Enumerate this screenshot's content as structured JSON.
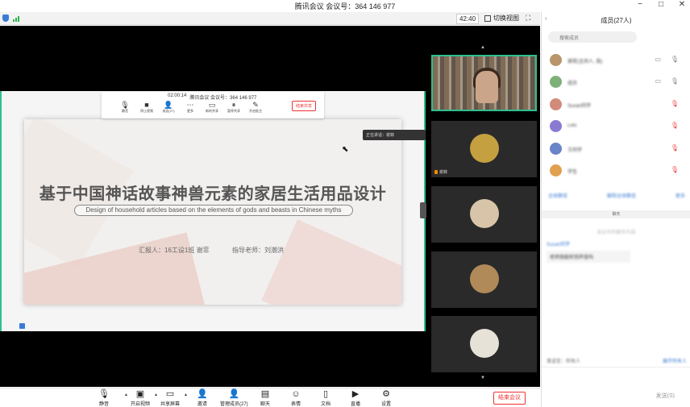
{
  "window": {
    "title": "腾讯会议 会议号：364 146 977",
    "buttons": [
      "−",
      "□",
      "✕"
    ]
  },
  "status": {
    "timer": "42:40",
    "switch_view": "切换视图",
    "fullscreen_icon": "⛶"
  },
  "share_bar": {
    "elapsed": "02:00:14",
    "meeting_id": "腾讯会议 会议号：364 146 977",
    "items": [
      {
        "label": "静音",
        "icon": "mic-icon"
      },
      {
        "label": "停止视频",
        "icon": "camera-icon"
      },
      {
        "label": "成员(27)",
        "icon": "members-icon"
      },
      {
        "label": "更多",
        "icon": "more-icon"
      },
      {
        "label": "新的共享",
        "icon": "share-icon"
      },
      {
        "label": "暂停共享",
        "icon": "pause-icon"
      },
      {
        "label": "开启批注",
        "icon": "annotate-icon"
      }
    ],
    "end_share": "结束共享"
  },
  "slide": {
    "title": "基于中国神话故事神兽元素的家居生活用品设计",
    "subtitle": "Design of household articles based on the elements of gods and beasts in Chinese myths",
    "reporter": "汇报人：16工设1班 谢菲",
    "advisor": "指导老师：刘潮洪"
  },
  "tooltip": "正在讲话：谢菲",
  "thumbnails": [
    "谢菲",
    "",
    "",
    "",
    ""
  ],
  "toolbar": {
    "items": [
      {
        "label": "静音",
        "icon": "mic-icon"
      },
      {
        "label": "开启视频",
        "icon": "camera-off-icon"
      },
      {
        "label": "共享屏幕",
        "icon": "share-screen-icon"
      },
      {
        "label": "邀请",
        "icon": "invite-icon"
      },
      {
        "label": "管理成员(27)",
        "icon": "members-icon"
      },
      {
        "label": "聊天",
        "icon": "chat-icon"
      },
      {
        "label": "表情",
        "icon": "emoji-icon"
      },
      {
        "label": "文档",
        "icon": "doc-icon"
      },
      {
        "label": "直播",
        "icon": "live-icon"
      },
      {
        "label": "设置",
        "icon": "settings-icon"
      }
    ],
    "end_meeting": "结束会议"
  },
  "panel": {
    "title": "成员(27人)",
    "collapse_icon": "‹",
    "search_placeholder": "搜索成员",
    "members": [
      "谢菲(主持人, 我)",
      "成员",
      "Susan同学",
      "Lulu",
      "王同学",
      "学生"
    ],
    "links": [
      "全体静音",
      "解除全体静音",
      "更多"
    ],
    "chat_header": "聊天",
    "chat_notice": "会议中的聊天内容",
    "chat_name": "Susan同学",
    "chat_message": "老师我能听到声音吗",
    "chat_to_label": "发送至：所有人",
    "chat_to_link": "展开所有人",
    "send": "发送(S)"
  }
}
